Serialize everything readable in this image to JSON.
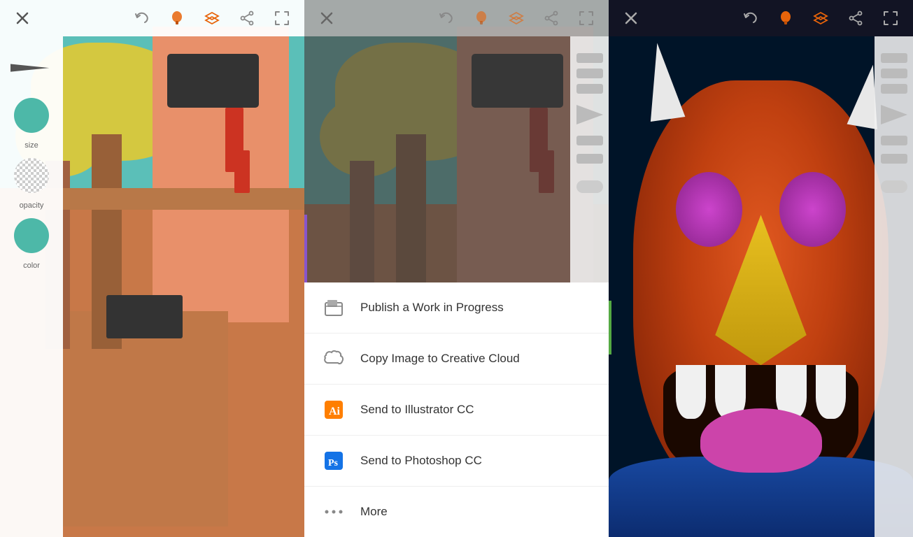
{
  "panels": [
    {
      "id": "panel-1",
      "toolbar": {
        "close_label": "×",
        "bg": "white"
      },
      "sidebar": {
        "labels": {
          "size": "size",
          "opacity": "opacity",
          "color": "color"
        }
      }
    },
    {
      "id": "panel-2",
      "toolbar": {
        "close_label": "×",
        "bg": "gray"
      }
    },
    {
      "id": "panel-3",
      "toolbar": {
        "close_label": "×",
        "bg": "dark"
      }
    }
  ],
  "menu": {
    "items": [
      {
        "id": "publish",
        "icon": "publish-icon",
        "label": "Publish a Work in Progress"
      },
      {
        "id": "copy-cc",
        "icon": "creative-cloud-icon",
        "label": "Copy Image to Creative Cloud"
      },
      {
        "id": "illustrator",
        "icon": "illustrator-icon",
        "label": "Send to Illustrator CC"
      },
      {
        "id": "photoshop",
        "icon": "photoshop-icon",
        "label": "Send to Photoshop CC"
      },
      {
        "id": "more",
        "icon": "more-icon",
        "label": "More"
      }
    ]
  },
  "toolbar": {
    "icons": {
      "close": "×",
      "undo": "↩",
      "brush": "brush",
      "layers": "layers",
      "share": "share",
      "fullscreen": "fullscreen"
    }
  },
  "colors": {
    "accent_orange": "#e8640a",
    "accent_teal": "#4db8a8",
    "menu_bg": "#ffffff",
    "toolbar_gray": "rgba(180,180,180,0.85)",
    "dark_bg": "#001428"
  }
}
